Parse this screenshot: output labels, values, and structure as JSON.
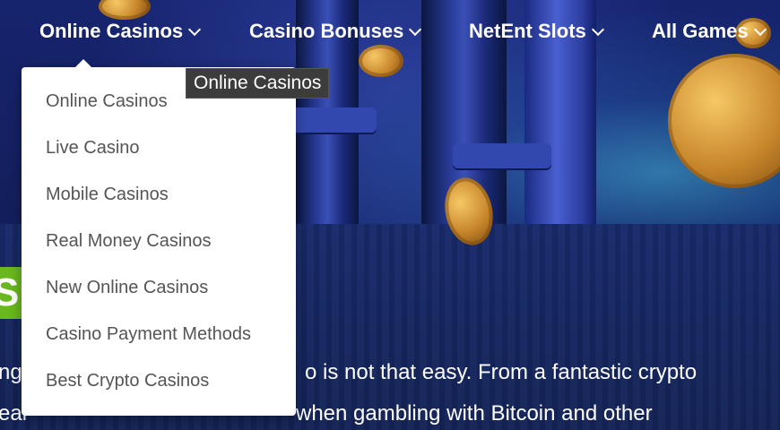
{
  "nav": {
    "items": [
      {
        "label": "Online Casinos"
      },
      {
        "label": "Casino Bonuses"
      },
      {
        "label": "NetEnt Slots"
      },
      {
        "label": "All Games"
      }
    ]
  },
  "dropdown": {
    "items": [
      {
        "label": "Online Casinos"
      },
      {
        "label": "Live Casino"
      },
      {
        "label": "Mobile Casinos"
      },
      {
        "label": "Real Money Casinos"
      },
      {
        "label": "New Online Casinos"
      },
      {
        "label": "Casino Payment Methods"
      },
      {
        "label": "Best Crypto Casinos"
      }
    ]
  },
  "tooltip": {
    "text": "Online Casinos"
  },
  "hero": {
    "badge_text": "S",
    "line1_left": "ng",
    "line1_right": "o is not that easy. From a fantastic crypto",
    "line2_left": "eal",
    "line2_right": "when gambling with Bitcoin and other"
  }
}
